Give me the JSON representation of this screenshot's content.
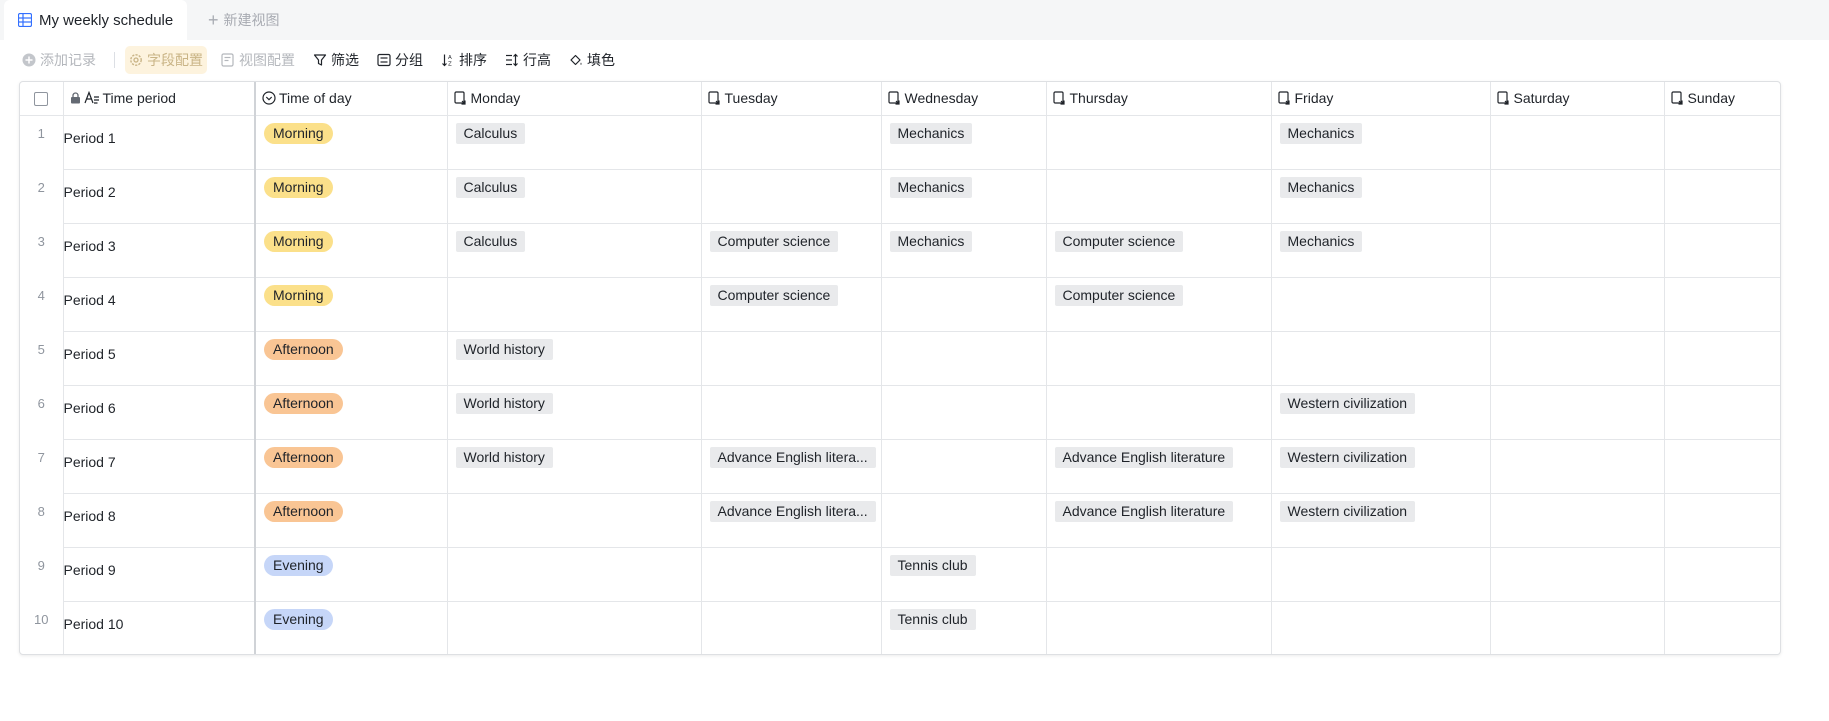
{
  "tabs": {
    "active_label": "My weekly schedule",
    "new_view_label": "新建视图",
    "new_view_plus": "+"
  },
  "toolbar": {
    "add_record": "添加记录",
    "field_config": "字段配置",
    "view_config": "视图配置",
    "filter": "筛选",
    "group": "分组",
    "sort": "排序",
    "row_height": "行高",
    "fill_color": "填色"
  },
  "columns": {
    "time_period": "Time period",
    "time_of_day": "Time of day",
    "monday": "Monday",
    "tuesday": "Tuesday",
    "wednesday": "Wednesday",
    "thursday": "Thursday",
    "friday": "Friday",
    "saturday": "Saturday",
    "sunday": "Sunday"
  },
  "colors": {
    "morning": "#fbe08a",
    "afternoon": "#f9c594",
    "evening": "#c6d6f8"
  },
  "rows": [
    {
      "index": "1",
      "period": "Period 1",
      "time_of_day": "Morning",
      "tod_type": "morning",
      "monday": "Calculus",
      "tuesday": "",
      "wednesday": "Mechanics",
      "thursday": "",
      "friday": "Mechanics",
      "saturday": "",
      "sunday": ""
    },
    {
      "index": "2",
      "period": "Period 2",
      "time_of_day": "Morning",
      "tod_type": "morning",
      "monday": "Calculus",
      "tuesday": "",
      "wednesday": "Mechanics",
      "thursday": "",
      "friday": "Mechanics",
      "saturday": "",
      "sunday": ""
    },
    {
      "index": "3",
      "period": "Period 3",
      "time_of_day": "Morning",
      "tod_type": "morning",
      "monday": "Calculus",
      "tuesday": "Computer science",
      "wednesday": "Mechanics",
      "thursday": "Computer science",
      "friday": "Mechanics",
      "saturday": "",
      "sunday": ""
    },
    {
      "index": "4",
      "period": "Period 4",
      "time_of_day": "Morning",
      "tod_type": "morning",
      "monday": "",
      "tuesday": "Computer science",
      "wednesday": "",
      "thursday": "Computer science",
      "friday": "",
      "saturday": "",
      "sunday": ""
    },
    {
      "index": "5",
      "period": "Period 5",
      "time_of_day": "Afternoon",
      "tod_type": "afternoon",
      "monday": "World history",
      "tuesday": "",
      "wednesday": "",
      "thursday": "",
      "friday": "",
      "saturday": "",
      "sunday": ""
    },
    {
      "index": "6",
      "period": "Period 6",
      "time_of_day": "Afternoon",
      "tod_type": "afternoon",
      "monday": "World history",
      "tuesday": "",
      "wednesday": "",
      "thursday": "",
      "friday": "Western civilization",
      "saturday": "",
      "sunday": ""
    },
    {
      "index": "7",
      "period": "Period 7",
      "time_of_day": "Afternoon",
      "tod_type": "afternoon",
      "monday": "World history",
      "tuesday": "Advance English litera...",
      "wednesday": "",
      "thursday": "Advance English literature",
      "friday": "Western civilization",
      "saturday": "",
      "sunday": ""
    },
    {
      "index": "8",
      "period": "Period 8",
      "time_of_day": "Afternoon",
      "tod_type": "afternoon",
      "monday": "",
      "tuesday": "Advance English litera...",
      "wednesday": "",
      "thursday": "Advance English literature",
      "friday": "Western civilization",
      "saturday": "",
      "sunday": ""
    },
    {
      "index": "9",
      "period": "Period 9",
      "time_of_day": "Evening",
      "tod_type": "evening",
      "monday": "",
      "tuesday": "",
      "wednesday": "Tennis club",
      "thursday": "",
      "friday": "",
      "saturday": "",
      "sunday": ""
    },
    {
      "index": "10",
      "period": "Period 10",
      "time_of_day": "Evening",
      "tod_type": "evening",
      "monday": "",
      "tuesday": "",
      "wednesday": "Tennis club",
      "thursday": "",
      "friday": "",
      "saturday": "",
      "sunday": ""
    }
  ]
}
